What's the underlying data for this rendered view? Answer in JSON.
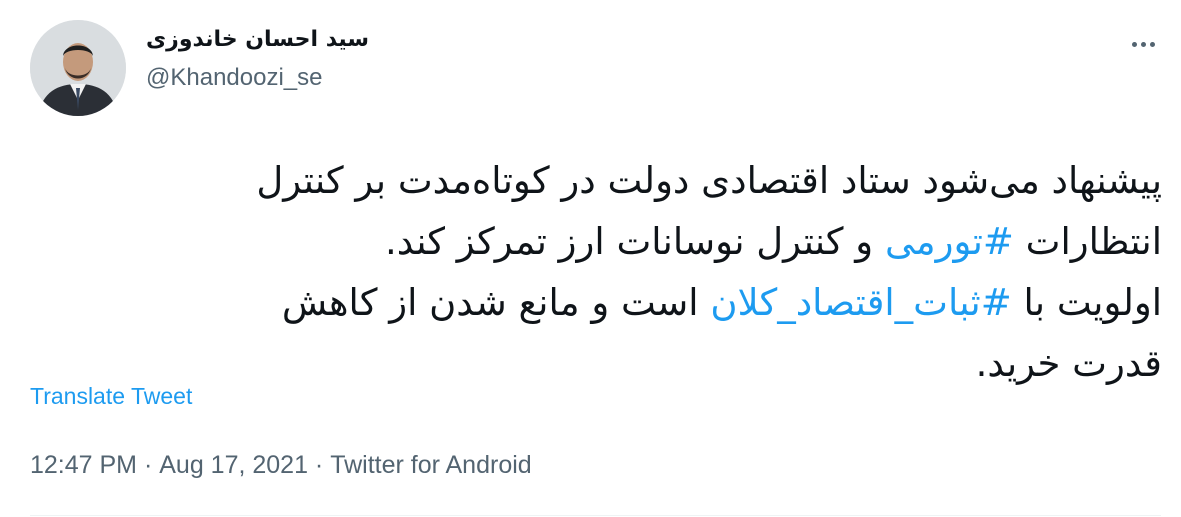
{
  "author": {
    "display_name": "سید احسان خاندوزی",
    "handle": "@Khandoozi_se"
  },
  "tweet": {
    "line1": "پیشنهاد می‌شود ستاد اقتصادی دولت در کوتاه‌مدت بر کنترل",
    "line2_before": "انتظارات ",
    "hashtag1": "#تورمی",
    "line2_after": " و کنترل نوسانات ارز تمرکز کند.",
    "line3_before": "اولویت با ",
    "hashtag2": "#ثبات_اقتصاد_کلان",
    "line3_after": " است و مانع شدن از کاهش",
    "line4": "قدرت خرید."
  },
  "translate_label": "Translate Tweet",
  "meta": {
    "time": "12:47 PM",
    "date": "Aug 17, 2021",
    "source": "Twitter for Android",
    "separator": " · "
  },
  "icons": {
    "more": "more-options-icon",
    "avatar": "profile-photo"
  },
  "colors": {
    "link": "#1d9bf0",
    "text": "#0f1419",
    "secondary": "#536471"
  }
}
